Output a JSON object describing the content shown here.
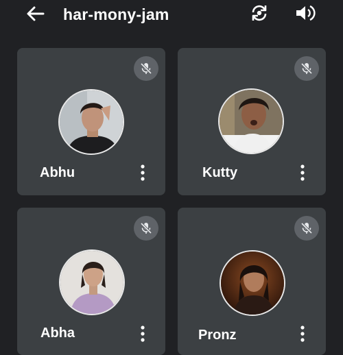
{
  "header": {
    "title": "har-mony-jam",
    "back_icon": "arrow-back-icon",
    "switch_camera_icon": "switch-camera-icon",
    "speaker_icon": "volume-up-icon"
  },
  "participants": [
    {
      "name": "Abhu",
      "mic_icon": "mic-off-icon",
      "menu_icon": "more-vert-icon"
    },
    {
      "name": "Kutty",
      "mic_icon": "mic-off-icon",
      "menu_icon": "more-vert-icon"
    },
    {
      "name": "Abha",
      "mic_icon": "mic-off-icon",
      "menu_icon": "more-vert-icon"
    },
    {
      "name": "Pronz",
      "mic_icon": "mic-off-icon",
      "menu_icon": "more-vert-icon"
    }
  ],
  "colors": {
    "background": "#202124",
    "tile": "#3c4043",
    "mic_badge": "#5f6368",
    "text": "#ffffff"
  }
}
